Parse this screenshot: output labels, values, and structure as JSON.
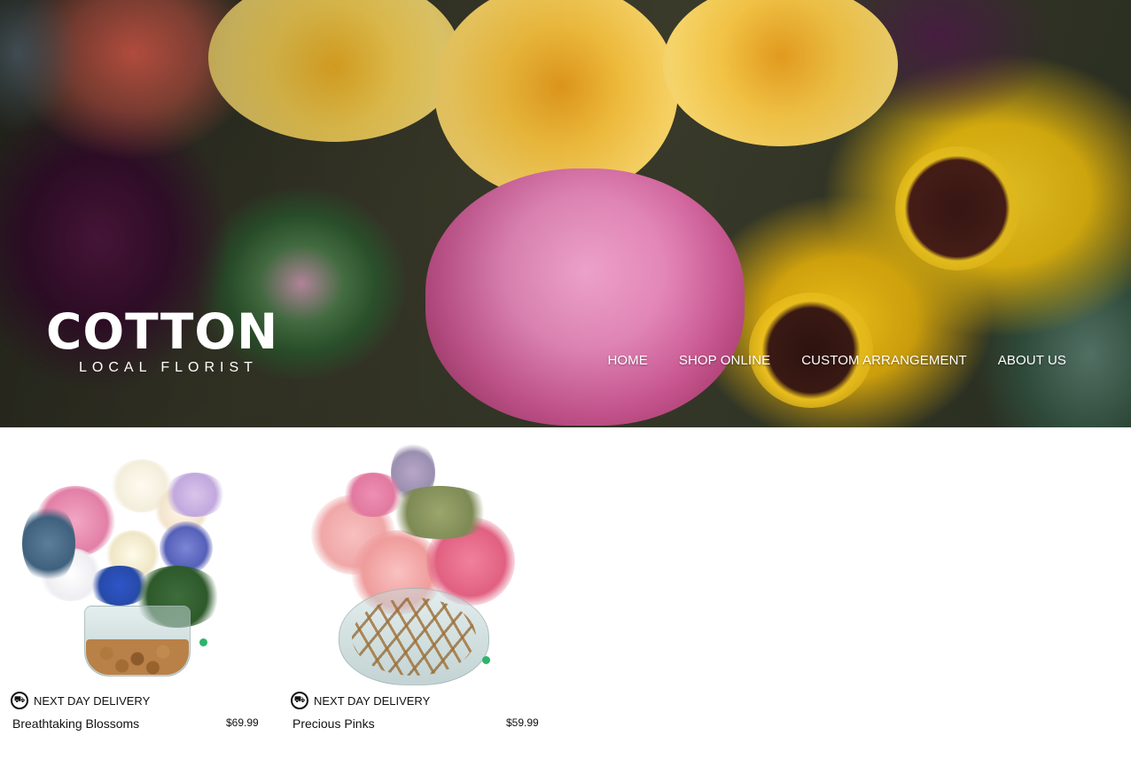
{
  "brand": {
    "name": "COTTON",
    "tagline": "LOCAL FLORIST"
  },
  "nav": {
    "items": [
      {
        "label": "HOME"
      },
      {
        "label": "SHOP ONLINE"
      },
      {
        "label": "CUSTOM ARRANGEMENT"
      },
      {
        "label": "ABOUT US"
      }
    ]
  },
  "products": [
    {
      "delivery_label": "NEXT DAY DELIVERY",
      "name": "Breathtaking Blossoms",
      "price": "$69.99"
    },
    {
      "delivery_label": "NEXT DAY DELIVERY",
      "name": "Precious Pinks",
      "price": "$59.99"
    }
  ],
  "icons": {
    "delivery": "truck-icon"
  },
  "colors": {
    "nav_text": "#ffffff",
    "text": "#111111",
    "background": "#ffffff"
  }
}
